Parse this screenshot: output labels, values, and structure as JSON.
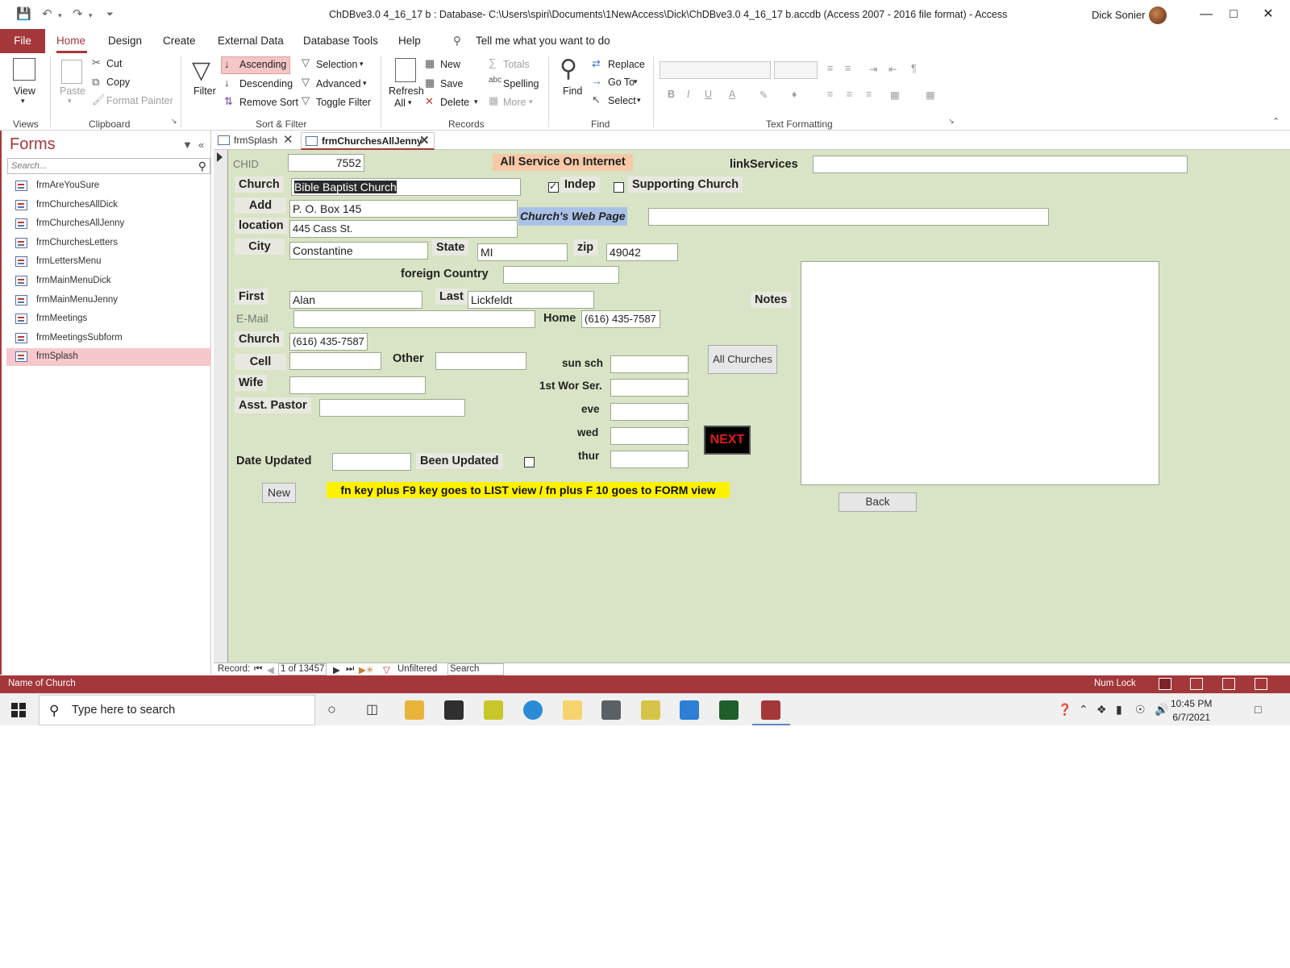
{
  "window": {
    "title": "ChDBve3.0 4_16_17 b : Database- C:\\Users\\spiri\\Documents\\1NewAccess\\Dick\\ChDBve3.0 4_16_17 b.accdb (Access 2007 - 2016 file format)  -  Access",
    "user": "Dick Sonier"
  },
  "ribbon": {
    "tabs": [
      "File",
      "Home",
      "Design",
      "Create",
      "External Data",
      "Database Tools",
      "Help"
    ],
    "tell_me": "Tell me what you want to do",
    "views": {
      "view": "View",
      "group": "Views"
    },
    "clipboard": {
      "paste": "Paste",
      "cut": "Cut",
      "copy": "Copy",
      "format_painter": "Format Painter",
      "group": "Clipboard"
    },
    "sort_filter": {
      "filter": "Filter",
      "ascending": "Ascending",
      "descending": "Descending",
      "remove_sort": "Remove Sort",
      "selection": "Selection",
      "advanced": "Advanced",
      "toggle_filter": "Toggle Filter",
      "group": "Sort & Filter"
    },
    "records": {
      "refresh": "Refresh",
      "refresh2": "All",
      "new": "New",
      "save": "Save",
      "delete": "Delete",
      "totals": "Totals",
      "spelling": "Spelling",
      "more": "More",
      "group": "Records"
    },
    "find": {
      "find": "Find",
      "replace": "Replace",
      "goto": "Go To",
      "select": "Select",
      "group": "Find"
    },
    "text_formatting": {
      "group": "Text Formatting",
      "bold": "B",
      "italic": "I",
      "underline": "U"
    }
  },
  "nav_pane": {
    "title": "Forms",
    "search_placeholder": "Search...",
    "items": [
      "frmAreYouSure",
      "frmChurchesAllDick",
      "frmChurchesAllJenny",
      "frmChurchesLetters",
      "frmLettersMenu",
      "frmMainMenuDick",
      "frmMainMenuJenny",
      "frmMeetings",
      "frmMeetingsSubform",
      "frmSplash"
    ],
    "selected": "frmSplash"
  },
  "doc_tabs": [
    "frmSplash",
    "frmChurchesAllJenny"
  ],
  "form": {
    "chid_label": "CHID",
    "chid": "7552",
    "all_service_label": "All Service On Internet",
    "link_services_label": "linkServices",
    "link_services": "",
    "church_label": "Church",
    "church": "Bible Baptist Church",
    "indep_label": "Indep",
    "indep_checked": true,
    "supporting_label": "Supporting Church",
    "supporting_checked": false,
    "add_label": "Add",
    "address": "P. O. Box 145",
    "location_label": "location",
    "location": "445 Cass St.",
    "web_page_label": "Church's Web Page",
    "web_page": "",
    "city_label": "City",
    "city": "Constantine",
    "state_label": "State",
    "state": "MI",
    "zip_label": "zip",
    "zip": "49042",
    "foreign_label": "foreign Country",
    "foreign": "",
    "first_label": "First",
    "first": "Alan",
    "last_label": "Last",
    "last": "Lickfeldt",
    "notes_label": "Notes",
    "notes": "",
    "email_label": "E-Mail",
    "email": "",
    "home_label": "Home",
    "home": "(616) 435-7587",
    "church_phone_label": "Church",
    "church_phone": "(616) 435-7587",
    "all_churches_button": "All Churches",
    "cell_label": "Cell",
    "cell": "",
    "other_label": "Other",
    "other": "",
    "sunsch_label": "sun sch",
    "sunsch": "",
    "wor_label": "1st Wor Ser.",
    "wor": "",
    "wife_label": "Wife",
    "wife": "",
    "eve_label": "eve",
    "eve": "",
    "asst_label": "Asst. Pastor",
    "asst": "",
    "wed_label": "wed",
    "wed": "",
    "next_button": "NEXT",
    "date_updated_label": "Date Updated",
    "date_updated": "",
    "been_updated_label": "Been Updated",
    "been_updated_checked": false,
    "thur_label": "thur",
    "thur": "",
    "new_button": "New",
    "info_text": "fn key  plus F9 key goes to LIST view / fn plus F 10 goes to FORM view",
    "back_button": "Back"
  },
  "record_nav": {
    "label": "Record:",
    "position": "1 of 13457",
    "filter": "Unfiltered",
    "search": "Search"
  },
  "status_bar": {
    "left": "Name of Church",
    "numlock": "Num Lock"
  },
  "taskbar": {
    "search_placeholder": "Type here to search",
    "time": "10:45 PM",
    "date": "6/7/2021"
  },
  "colors": {
    "accent": "#a4373a",
    "form_bg": "#d8e4c5",
    "nav_selected": "#f6c7cb"
  }
}
